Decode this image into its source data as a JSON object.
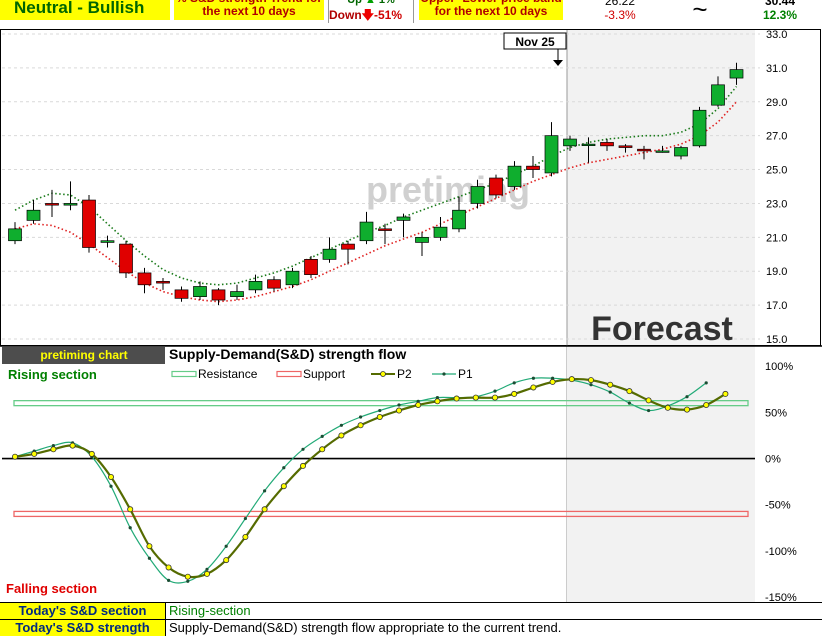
{
  "header": {
    "trend_label": "Neutral - Bullish",
    "strength_title": "% S&D strength Trend for the next 10 days",
    "up_label": "Up",
    "up_value": "1%",
    "down_label": "Down",
    "down_value": "-51%",
    "band_title": "Upper- Lower price band for the next 10 days",
    "price_value": "26.22",
    "price_change": "-3.3%",
    "tilde": "~",
    "last_value": "30.44",
    "last_change": "12.3%"
  },
  "chart_data": [
    {
      "type": "candlestick",
      "title": "",
      "watermark": "pretiming",
      "forecast_label": "Forecast",
      "date_marker": "Nov 25",
      "ylim": [
        15.0,
        33.0
      ],
      "ytick_labels": [
        "15.0",
        "17.0",
        "19.0",
        "21.0",
        "23.0",
        "25.0",
        "27.0",
        "29.0",
        "31.0",
        "33.0"
      ],
      "candles": [
        {
          "o": 20.8,
          "c": 21.5,
          "h": 21.9,
          "l": 20.6
        },
        {
          "o": 22.0,
          "c": 22.6,
          "h": 23.2,
          "l": 21.8
        },
        {
          "o": 23.0,
          "c": 22.9,
          "h": 23.8,
          "l": 22.2
        },
        {
          "o": 22.9,
          "c": 23.0,
          "h": 24.3,
          "l": 22.6
        },
        {
          "o": 23.2,
          "c": 20.4,
          "h": 23.5,
          "l": 20.1
        },
        {
          "o": 20.7,
          "c": 20.8,
          "h": 21.1,
          "l": 20.4
        },
        {
          "o": 20.6,
          "c": 18.9,
          "h": 20.8,
          "l": 18.6
        },
        {
          "o": 18.9,
          "c": 18.2,
          "h": 19.2,
          "l": 17.7
        },
        {
          "o": 18.4,
          "c": 18.3,
          "h": 18.6,
          "l": 17.9
        },
        {
          "o": 17.9,
          "c": 17.4,
          "h": 18.1,
          "l": 17.2
        },
        {
          "o": 17.5,
          "c": 18.1,
          "h": 18.4,
          "l": 17.3
        },
        {
          "o": 17.9,
          "c": 17.3,
          "h": 18.0,
          "l": 17.0
        },
        {
          "o": 17.5,
          "c": 17.8,
          "h": 18.2,
          "l": 17.3
        },
        {
          "o": 17.9,
          "c": 18.4,
          "h": 18.8,
          "l": 17.7
        },
        {
          "o": 18.5,
          "c": 18.0,
          "h": 18.7,
          "l": 17.8
        },
        {
          "o": 18.2,
          "c": 19.0,
          "h": 19.2,
          "l": 18.0
        },
        {
          "o": 19.7,
          "c": 18.8,
          "h": 19.9,
          "l": 18.6
        },
        {
          "o": 19.7,
          "c": 20.3,
          "h": 21.0,
          "l": 19.5
        },
        {
          "o": 20.6,
          "c": 20.3,
          "h": 20.8,
          "l": 19.4
        },
        {
          "o": 20.8,
          "c": 21.9,
          "h": 22.5,
          "l": 20.6
        },
        {
          "o": 21.5,
          "c": 21.4,
          "h": 21.8,
          "l": 20.6
        },
        {
          "o": 22.0,
          "c": 22.2,
          "h": 22.4,
          "l": 21.0
        },
        {
          "o": 20.7,
          "c": 21.0,
          "h": 21.3,
          "l": 19.9
        },
        {
          "o": 21.0,
          "c": 21.6,
          "h": 22.2,
          "l": 20.8
        },
        {
          "o": 21.5,
          "c": 22.6,
          "h": 23.4,
          "l": 21.3
        },
        {
          "o": 23.0,
          "c": 24.0,
          "h": 24.4,
          "l": 22.7
        },
        {
          "o": 24.5,
          "c": 23.5,
          "h": 24.7,
          "l": 23.3
        },
        {
          "o": 24.0,
          "c": 25.2,
          "h": 25.5,
          "l": 23.8
        },
        {
          "o": 25.2,
          "c": 25.0,
          "h": 25.8,
          "l": 24.5
        },
        {
          "o": 24.8,
          "c": 27.0,
          "h": 27.8,
          "l": 24.6
        },
        {
          "o": 26.4,
          "c": 26.8,
          "h": 27.0,
          "l": 26.1
        },
        {
          "o": 26.5,
          "c": 26.5,
          "h": 26.9,
          "l": 25.4
        },
        {
          "o": 26.6,
          "c": 26.4,
          "h": 26.8,
          "l": 26.1
        },
        {
          "o": 26.4,
          "c": 26.3,
          "h": 26.5,
          "l": 26.0
        },
        {
          "o": 26.2,
          "c": 26.1,
          "h": 26.4,
          "l": 25.6
        },
        {
          "o": 26.1,
          "c": 26.1,
          "h": 26.4,
          "l": 26.0
        },
        {
          "o": 25.8,
          "c": 26.3,
          "h": 26.4,
          "l": 25.6
        },
        {
          "o": 26.4,
          "c": 28.5,
          "h": 28.7,
          "l": 26.3
        },
        {
          "o": 28.8,
          "c": 30.0,
          "h": 30.5,
          "l": 28.7
        },
        {
          "o": 30.4,
          "c": 30.9,
          "h": 31.3,
          "l": 30.0
        }
      ],
      "upper_band": [
        22.6,
        23.2,
        23.6,
        23.5,
        22.8,
        21.8,
        20.8,
        19.9,
        19.1,
        18.6,
        18.3,
        18.2,
        18.3,
        18.6,
        18.9,
        19.3,
        19.8,
        20.3,
        20.8,
        21.3,
        21.7,
        22.2,
        22.6,
        23.0,
        23.4,
        23.8,
        24.2,
        24.7,
        25.2,
        25.8,
        26.3,
        26.6,
        26.8,
        26.9,
        27.0,
        27.0,
        27.2,
        27.7,
        28.6,
        29.9
      ],
      "lower_band": [
        21.5,
        21.8,
        21.7,
        21.3,
        20.6,
        19.8,
        19.0,
        18.3,
        17.8,
        17.5,
        17.3,
        17.2,
        17.3,
        17.5,
        17.8,
        18.1,
        18.5,
        19.0,
        19.5,
        20.0,
        20.5,
        20.9,
        21.3,
        21.8,
        22.3,
        22.8,
        23.3,
        23.8,
        24.3,
        24.7,
        25.1,
        25.4,
        25.6,
        25.8,
        26.0,
        26.2,
        26.5,
        27.0,
        27.8,
        29.0
      ]
    },
    {
      "type": "line",
      "title": "Supply-Demand(S&D)  strength flow",
      "chart_name_label": "pretiming chart",
      "rising_label": "Rising section",
      "falling_label": "Falling section",
      "ylim": [
        -150,
        110
      ],
      "ytick_labels": [
        "-150%",
        "-100%",
        "-50%",
        "0%",
        "50%",
        "100%"
      ],
      "resistance": 60,
      "support": -60,
      "series": [
        {
          "name": "Resistance",
          "color": "#66cc88"
        },
        {
          "name": "Support",
          "color": "#ee6666"
        },
        {
          "name": "P2",
          "color": "#556b00",
          "values": [
            2,
            5,
            10,
            14,
            5,
            -20,
            -55,
            -95,
            -118,
            -128,
            -125,
            -110,
            -85,
            -55,
            -30,
            -8,
            10,
            25,
            36,
            45,
            52,
            58,
            62,
            65,
            66,
            66,
            70,
            77,
            83,
            86,
            85,
            80,
            73,
            63,
            55,
            53,
            58,
            70
          ]
        },
        {
          "name": "P1",
          "color": "#22aa77",
          "values": [
            2,
            8,
            14,
            17,
            2,
            -30,
            -75,
            -108,
            -132,
            -133,
            -120,
            -95,
            -65,
            -35,
            -10,
            10,
            24,
            36,
            45,
            52,
            58,
            62,
            66,
            66,
            67,
            73,
            82,
            87,
            87,
            85,
            80,
            72,
            60,
            52,
            57,
            67,
            82
          ]
        }
      ]
    }
  ],
  "footer": {
    "section_label": "Today's S&D section",
    "section_value": "Rising-section",
    "strength_label": "Today's S&D strength",
    "strength_value": "Supply-Demand(S&D) strength flow appropriate to the current trend."
  }
}
